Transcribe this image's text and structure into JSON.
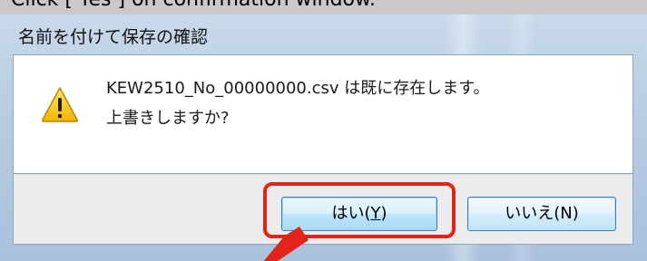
{
  "instruction": {
    "text": "Click [ Yes ] on confirmation window."
  },
  "dialog": {
    "title": "名前を付けて保存の確認",
    "icon": "warning-icon",
    "message_line1": "KEW2510_No_00000000.csv は既に存在します。",
    "message_line2": "上書きしますか?",
    "buttons": {
      "yes": {
        "prefix": "はい(",
        "mnemonic": "Y",
        "suffix": ")"
      },
      "no": {
        "label": "いいえ(N)"
      }
    }
  },
  "colors": {
    "highlight": "#e2231a",
    "arrow": "#e2231a",
    "warning_fill": "#f5c400"
  }
}
